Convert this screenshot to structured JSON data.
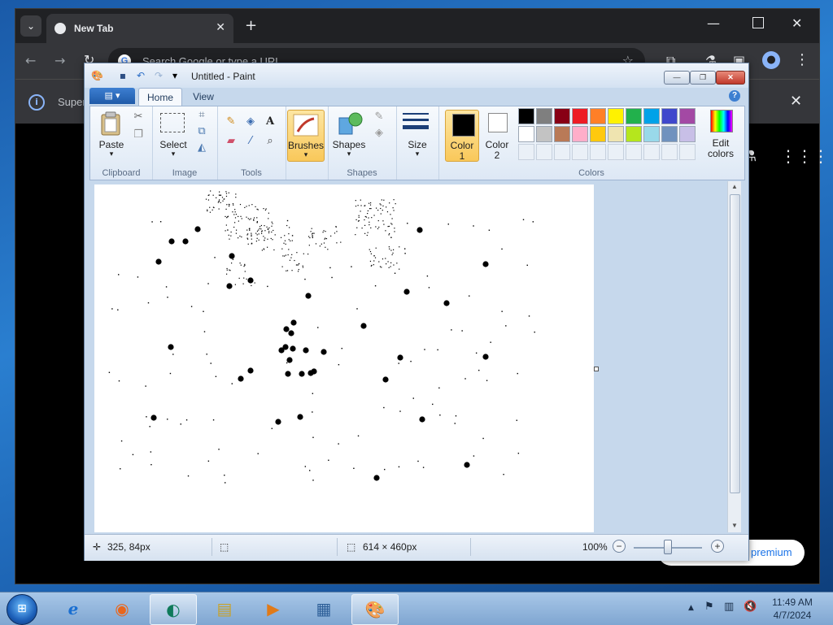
{
  "chrome": {
    "tab_search_glyph": "⌄",
    "tab_title": "New Tab",
    "tab_close": "✕",
    "new_tab": "+",
    "window_min": "—",
    "window_close": "✕",
    "nav_back": "←",
    "nav_forward": "→",
    "nav_reload": "↻",
    "omnibox_g": "G",
    "omnibox_placeholder": "Search Google or type a URL",
    "star": "☆",
    "extensions": "⧉",
    "lab": "⚗",
    "sidepanel": "▣",
    "profile": "●",
    "menu": "⋮",
    "info_icon": "i",
    "info_text": "Super",
    "info_close": "✕",
    "page_lab": "⚗",
    "page_apps": "⋮⋮⋮",
    "premium_text": "premium"
  },
  "paint": {
    "title": "Untitled - Paint",
    "qat": {
      "app": "🎨",
      "save": "▪",
      "undo": "↶",
      "redo": "↷",
      "more": "▾"
    },
    "win": {
      "min": "—",
      "max": "❐",
      "close": "✕"
    },
    "tabs": {
      "file": "▤ ▾",
      "home": "Home",
      "view": "View",
      "help": "?"
    },
    "clipboard": {
      "paste": "Paste",
      "paste_arrow": "▾",
      "group": "Clipboard"
    },
    "image": {
      "select": "Select",
      "select_arrow": "▾",
      "group": "Image"
    },
    "tools": {
      "group": "Tools"
    },
    "brushes": {
      "label": "Brushes",
      "arrow": "▾"
    },
    "shapes": {
      "label": "Shapes",
      "arrow": "▾",
      "group": "Shapes"
    },
    "size": {
      "label": "Size",
      "arrow": "▾"
    },
    "colors": {
      "color1_label": "Color",
      "color1_num": "1",
      "color2_label": "Color",
      "color2_num": "2",
      "edit_label": "Edit",
      "edit_label2": "colors",
      "group": "Colors",
      "color1": "#000000",
      "color2": "#ffffff",
      "palette_row1": [
        "#000000",
        "#7f7f7f",
        "#880015",
        "#ed1c24",
        "#ff7f27",
        "#fff200",
        "#22b14c",
        "#00a2e8",
        "#3f48cc",
        "#a349a4"
      ],
      "palette_row2": [
        "#ffffff",
        "#c3c3c3",
        "#b97a57",
        "#ffaec9",
        "#ffc90e",
        "#efe4b0",
        "#b5e61d",
        "#99d9ea",
        "#7092be",
        "#c8bfe7"
      ]
    },
    "status": {
      "position": "325, 84px",
      "size": "614 × 460px",
      "zoom": "100%",
      "zoom_minus": "−",
      "zoom_plus": "+"
    }
  },
  "taskbar": {
    "start": "⊞",
    "items": [
      "e",
      "◉",
      "◐",
      "▤",
      "▶",
      "▦",
      "🎨"
    ],
    "tray_up": "▲",
    "tray_flag": "⚑",
    "tray_net": "▥",
    "tray_vol": "🔇",
    "time": "11:49 AM",
    "date": "4/7/2024"
  }
}
